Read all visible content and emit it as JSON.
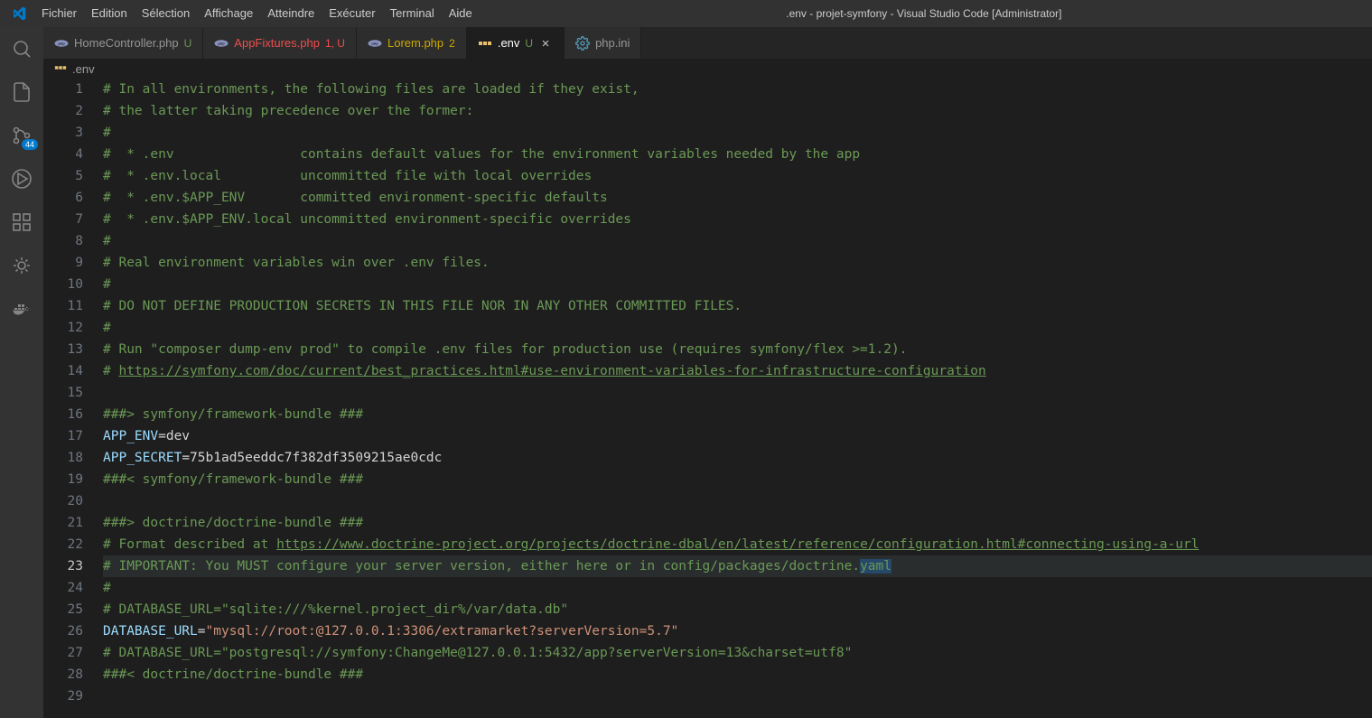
{
  "menubar": {
    "items": [
      "Fichier",
      "Edition",
      "Sélection",
      "Affichage",
      "Atteindre",
      "Exécuter",
      "Terminal",
      "Aide"
    ],
    "title": ".env - projet-symfony - Visual Studio Code [Administrator]"
  },
  "activitybar": {
    "badge": "44"
  },
  "tabs": [
    {
      "label": "HomeController.php",
      "status": "U",
      "statusClass": "",
      "icon": "php",
      "active": false,
      "closable": false
    },
    {
      "label": "AppFixtures.php",
      "status": "1, U",
      "statusClass": "err",
      "icon": "php",
      "active": false,
      "closable": false,
      "labelClass": "err"
    },
    {
      "label": "Lorem.php",
      "status": "2",
      "statusClass": "warn",
      "icon": "php",
      "active": false,
      "closable": false,
      "labelClass": "warn"
    },
    {
      "label": ".env",
      "status": "U",
      "statusClass": "",
      "icon": "env",
      "active": true,
      "closable": true
    },
    {
      "label": "php.ini",
      "status": "",
      "statusClass": "",
      "icon": "gear",
      "active": false,
      "closable": false
    }
  ],
  "breadcrumbs": {
    "file": ".env",
    "icon": "env"
  },
  "code": {
    "active_line": 23,
    "lines": [
      [
        {
          "c": "comment",
          "t": "# In all environments, the following files are loaded if they exist,"
        }
      ],
      [
        {
          "c": "comment",
          "t": "# the latter taking precedence over the former:"
        }
      ],
      [
        {
          "c": "comment",
          "t": "#"
        }
      ],
      [
        {
          "c": "comment",
          "t": "#  * .env                contains default values for the environment variables needed by the app"
        }
      ],
      [
        {
          "c": "comment",
          "t": "#  * .env.local          uncommitted file with local overrides"
        }
      ],
      [
        {
          "c": "comment",
          "t": "#  * .env.$APP_ENV       committed environment-specific defaults"
        }
      ],
      [
        {
          "c": "comment",
          "t": "#  * .env.$APP_ENV.local uncommitted environment-specific overrides"
        }
      ],
      [
        {
          "c": "comment",
          "t": "#"
        }
      ],
      [
        {
          "c": "comment",
          "t": "# Real environment variables win over .env files."
        }
      ],
      [
        {
          "c": "comment",
          "t": "#"
        }
      ],
      [
        {
          "c": "comment",
          "t": "# DO NOT DEFINE PRODUCTION SECRETS IN THIS FILE NOR IN ANY OTHER COMMITTED FILES."
        }
      ],
      [
        {
          "c": "comment",
          "t": "#"
        }
      ],
      [
        {
          "c": "comment",
          "t": "# Run \"composer dump-env prod\" to compile .env files for production use (requires symfony/flex >=1.2)."
        }
      ],
      [
        {
          "c": "comment",
          "t": "# "
        },
        {
          "c": "comment underline",
          "t": "https://symfony.com/doc/current/best_practices.html#use-environment-variables-for-infrastructure-configuration"
        }
      ],
      [],
      [
        {
          "c": "comment",
          "t": "###> symfony/framework-bundle ###"
        }
      ],
      [
        {
          "c": "variable",
          "t": "APP_ENV"
        },
        {
          "c": "value",
          "t": "=dev"
        }
      ],
      [
        {
          "c": "variable",
          "t": "APP_SECRET"
        },
        {
          "c": "value",
          "t": "=75b1ad5eeddc7f382df3509215ae0cdc"
        }
      ],
      [
        {
          "c": "comment",
          "t": "###< symfony/framework-bundle ###"
        }
      ],
      [],
      [
        {
          "c": "comment",
          "t": "###> doctrine/doctrine-bundle ###"
        }
      ],
      [
        {
          "c": "comment",
          "t": "# Format described at "
        },
        {
          "c": "comment underline",
          "t": "https://www.doctrine-project.org/projects/doctrine-dbal/en/latest/reference/configuration.html#connecting-using-a-url"
        }
      ],
      [
        {
          "c": "comment",
          "t": "# IMPORTANT: You MUST configure your server version, either here or in config/packages/doctrine."
        },
        {
          "c": "comment sel",
          "t": "yaml"
        }
      ],
      [
        {
          "c": "comment",
          "t": "#"
        }
      ],
      [
        {
          "c": "comment",
          "t": "# DATABASE_URL=\"sqlite:///%kernel.project_dir%/var/data.db\""
        }
      ],
      [
        {
          "c": "variable",
          "t": "DATABASE_URL"
        },
        {
          "c": "value",
          "t": "="
        },
        {
          "c": "string",
          "t": "\"mysql://root:@127.0.0.1:3306/extramarket?serverVersion=5.7\""
        }
      ],
      [
        {
          "c": "comment",
          "t": "# DATABASE_URL=\"postgresql://symfony:ChangeMe@127.0.0.1:5432/app?serverVersion=13&charset=utf8\""
        }
      ],
      [
        {
          "c": "comment",
          "t": "###< doctrine/doctrine-bundle ###"
        }
      ],
      []
    ]
  }
}
